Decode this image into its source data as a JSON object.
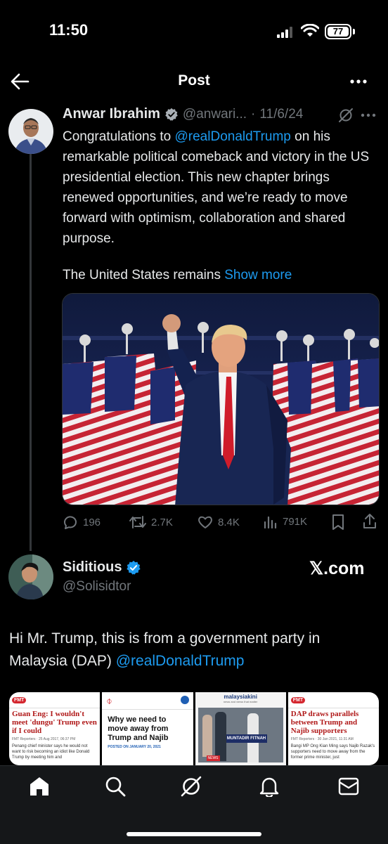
{
  "status_bar": {
    "time": "11:50",
    "battery": "77"
  },
  "header": {
    "title": "Post"
  },
  "tweet": {
    "name": "Anwar Ibrahim",
    "handle": "@anwari...",
    "sep": "·",
    "date": "11/6/24",
    "text_pre": "Congratulations to ",
    "mention": "@realDonaldTrump",
    "text_post": " on his remarkable political comeback and victory in the US presidential election. This new chapter brings renewed opportunities, and we’re ready to move forward with optimism, collaboration and shared purpose.",
    "text2": "The United States remains ",
    "show_more": "Show more",
    "stats": {
      "replies": "196",
      "reposts": "2.7K",
      "likes": "8.4K",
      "views": "791K"
    }
  },
  "reply": {
    "name": "Siditious",
    "handle": "@Solisidtor",
    "watermark": "𝕏.com",
    "text_pre": "Hi Mr. Trump, this is from a government party in Malaysia (DAP) ",
    "mention": "@realDonaldTrump"
  },
  "cards": [
    {
      "logo": "FMT",
      "headline": "Guan Eng: I wouldn't meet 'dungu' Trump even if I could",
      "byline": "FMT Reporters",
      "date": "25 Aug 2017, 06:37 PM",
      "body": "Penang chief minister says he would not want to risk becoming an idiot like Donald Trump by meeting him and"
    },
    {
      "headline": "Why we need to move away from Trump and Najib",
      "byline": "POSTED ON JANUARY 20, 2021"
    },
    {
      "logo": "malaysiakini",
      "tagline": "news and views that matter",
      "sign": "MUNTADIR FITNAH",
      "badge": "NEWS"
    },
    {
      "logo": "FMT",
      "headline": "DAP draws parallels between Trump and Najib supporters",
      "byline": "FMT Reporters",
      "date": "30 Jan 2021, 11:31 AM",
      "body": "Bangi MP Ong Kian Ming says Najib Razak's supporters need to move away from the former prime minister, just"
    }
  ],
  "colors": {
    "accent": "#1d9bf0",
    "bg": "#000000",
    "muted": "#71767b",
    "verified": "#1d9bf0"
  },
  "icons": [
    "signal-icon",
    "wifi-icon",
    "battery-icon",
    "back-arrow-icon",
    "more-icon",
    "verified-icon",
    "grok-icon",
    "reply-icon",
    "repost-icon",
    "like-icon",
    "views-icon",
    "bookmark-icon",
    "share-icon",
    "home-icon",
    "search-icon",
    "notifications-icon",
    "messages-icon"
  ]
}
